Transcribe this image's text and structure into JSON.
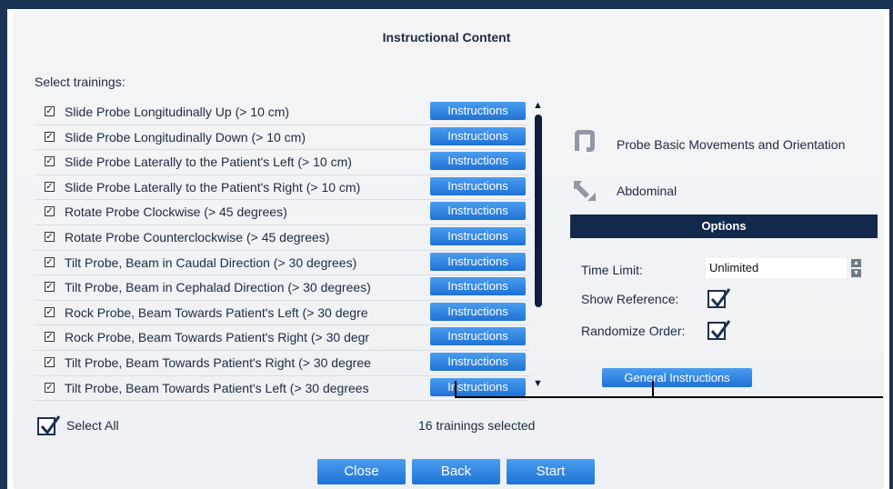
{
  "dialog": {
    "title": "Instructional Content"
  },
  "select_label": "Select trainings:",
  "trainings": [
    {
      "label": "Slide Probe Longitudinally Up (> 10 cm)",
      "checked": true,
      "button": "Instructions"
    },
    {
      "label": "Slide Probe Longitudinally Down (> 10 cm)",
      "checked": true,
      "button": "Instructions"
    },
    {
      "label": "Slide Probe Laterally to the Patient's Left (> 10 cm)",
      "checked": true,
      "button": "Instructions"
    },
    {
      "label": "Slide Probe Laterally to the Patient's Right (> 10 cm)",
      "checked": true,
      "button": "Instructions"
    },
    {
      "label": "Rotate Probe Clockwise (> 45 degrees)",
      "checked": true,
      "button": "Instructions"
    },
    {
      "label": "Rotate Probe Counterclockwise (> 45 degrees)",
      "checked": true,
      "button": "Instructions"
    },
    {
      "label": "Tilt Probe, Beam in Caudal Direction (> 30 degrees)",
      "checked": true,
      "button": "Instructions"
    },
    {
      "label": "Tilt Probe, Beam in Cephalad Direction (> 30 degrees)",
      "checked": true,
      "button": "Instructions"
    },
    {
      "label": "Rock Probe, Beam Towards Patient's Left (> 30 degre",
      "checked": true,
      "button": "Instructions"
    },
    {
      "label": "Rock Probe, Beam Towards Patient's Right (> 30 degr",
      "checked": true,
      "button": "Instructions"
    },
    {
      "label": "Tilt Probe, Beam Towards Patient's Right (> 30 degree",
      "checked": true,
      "button": "Instructions"
    },
    {
      "label": "Tilt Probe, Beam Towards Patient's Left (> 30 degrees",
      "checked": true,
      "button": "Instructions"
    }
  ],
  "module": {
    "name": "Probe Basic Movements and Orientation",
    "icon": "colon-icon"
  },
  "category": {
    "name": "Abdominal",
    "icon": "probe-icon"
  },
  "options": {
    "header": "Options",
    "time_limit_label": "Time Limit:",
    "time_limit_value": "Unlimited",
    "show_reference_label": "Show Reference:",
    "show_reference": true,
    "randomize_label": "Randomize Order:",
    "randomize": true,
    "general_instructions": "General Instructions"
  },
  "select_all": {
    "label": "Select All",
    "checked": true
  },
  "selected_count": "16 trainings selected",
  "buttons": {
    "close": "Close",
    "back": "Back",
    "start": "Start"
  },
  "colors": {
    "accent": "#2a82e0",
    "header_bar": "#13294b",
    "frame": "#1b3455"
  }
}
